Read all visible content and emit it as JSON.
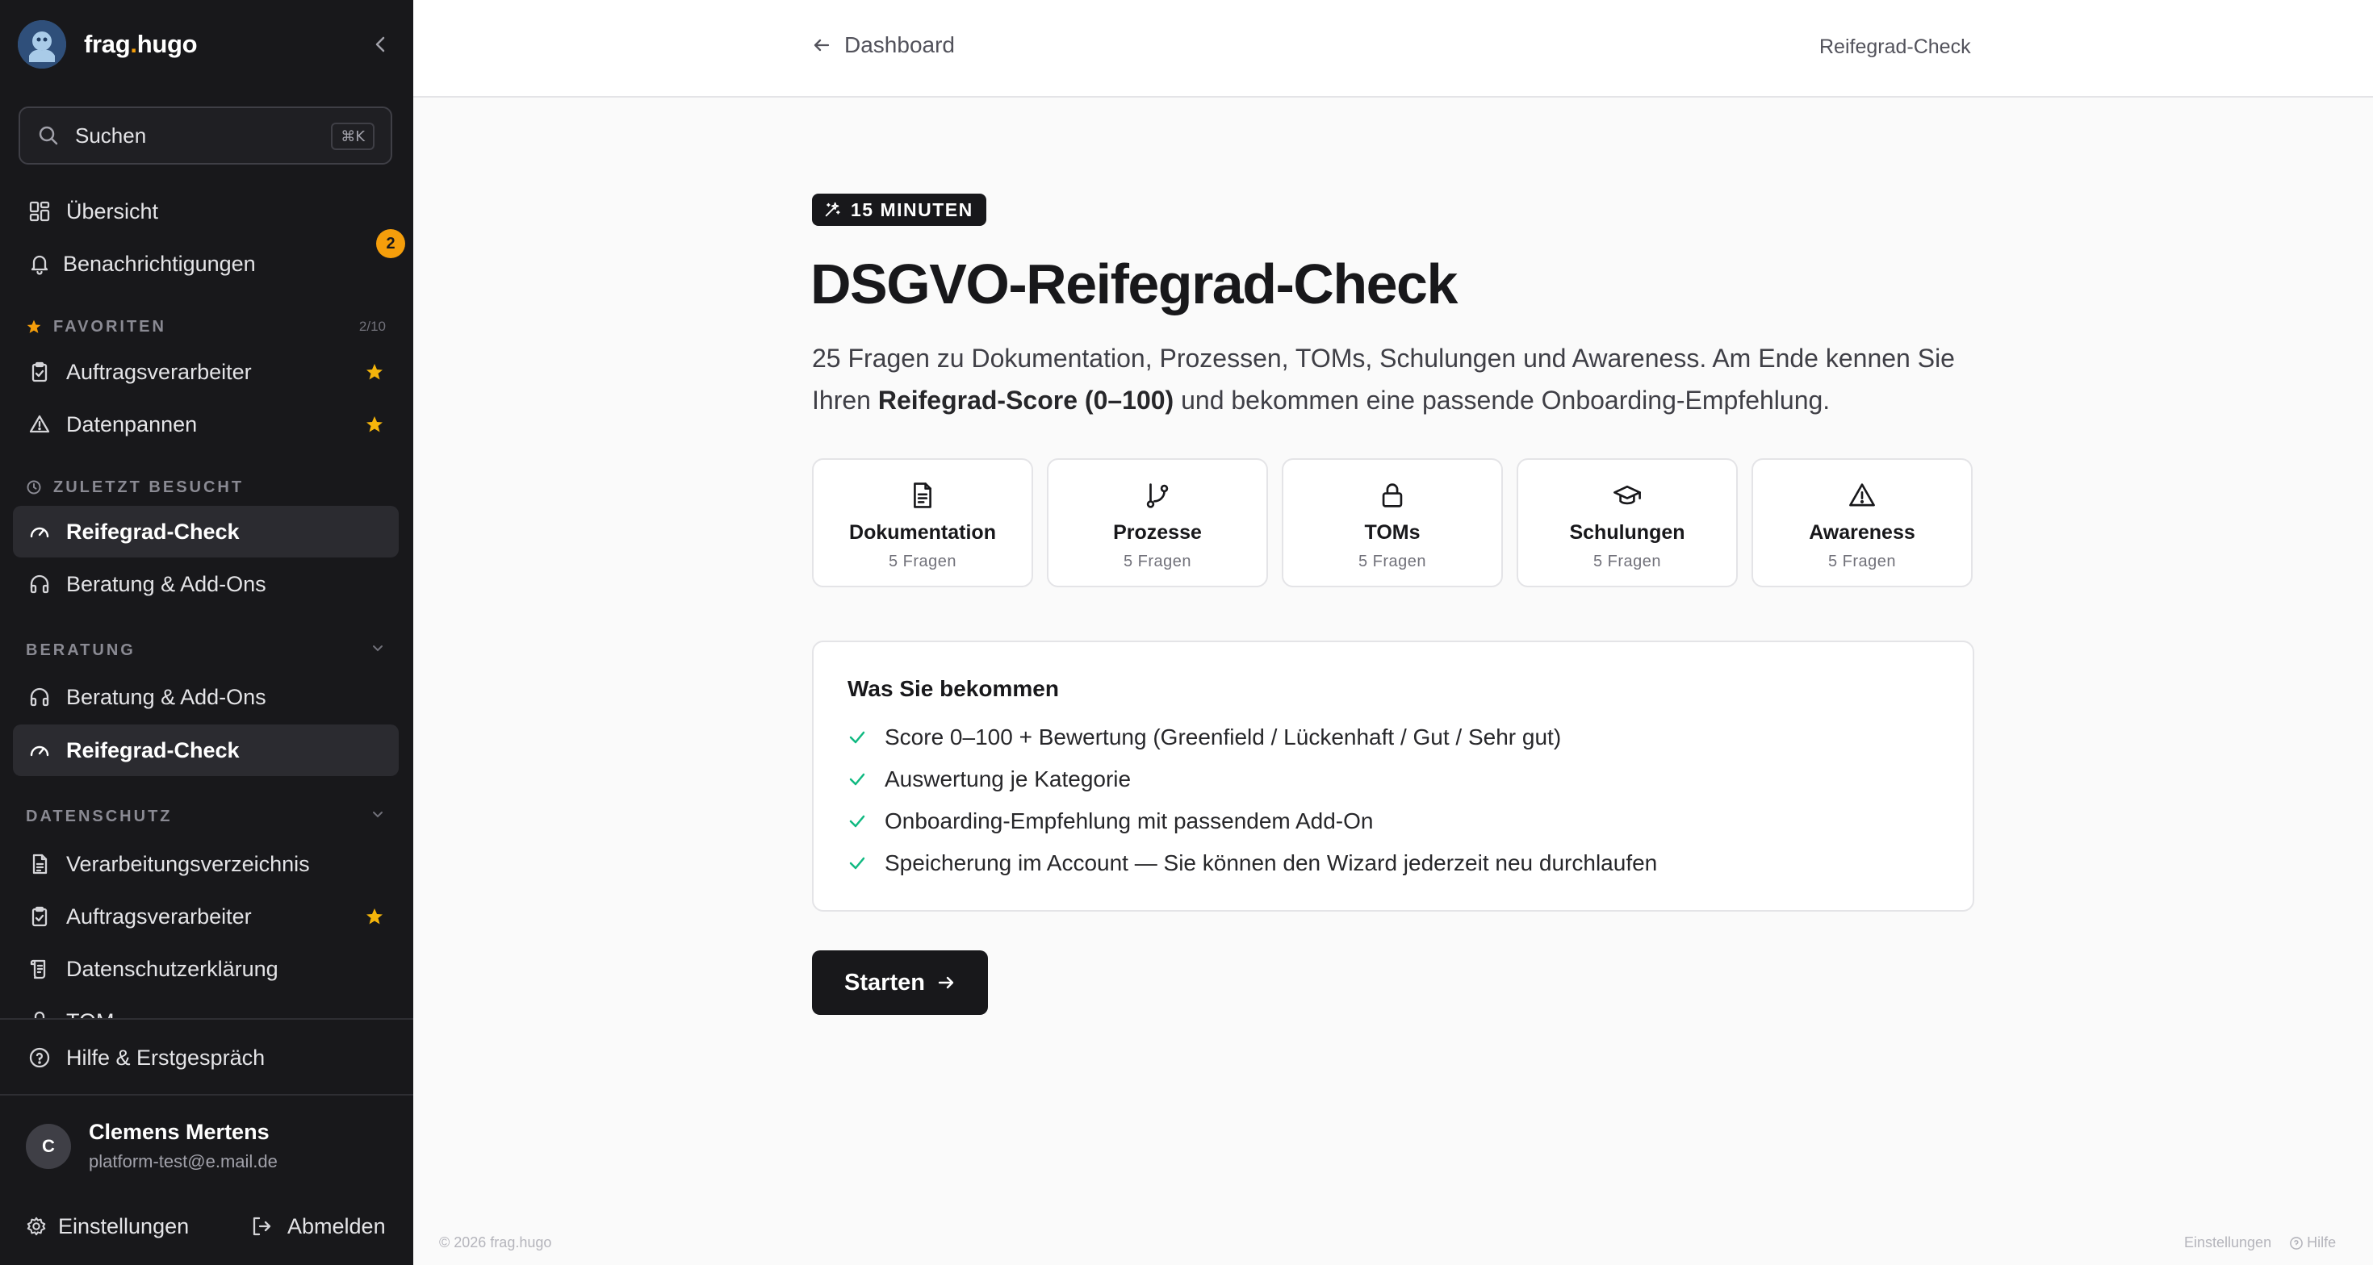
{
  "sidebar": {
    "brand": {
      "prefix": "frag",
      "dot": ".",
      "suffix": "hugo"
    },
    "search": {
      "label": "Suchen",
      "shortcut": "⌘K"
    },
    "main_items": [
      {
        "label": "Übersicht",
        "icon": "grid-icon"
      },
      {
        "label": "Benachrichtigungen",
        "icon": "bell-icon",
        "badge": "2"
      }
    ],
    "favorites": {
      "heading": "FAVORITEN",
      "count": "2/10",
      "items": [
        {
          "label": "Auftragsverarbeiter",
          "icon": "clipboard-check-icon",
          "starred": true
        },
        {
          "label": "Datenpannen",
          "icon": "warning-icon",
          "starred": true
        }
      ]
    },
    "recent": {
      "heading": "ZULETZT BESUCHT",
      "items": [
        {
          "label": "Reifegrad-Check",
          "icon": "gauge-icon",
          "active": true
        },
        {
          "label": "Beratung & Add-Ons",
          "icon": "headphones-icon"
        }
      ]
    },
    "beratung": {
      "heading": "BERATUNG",
      "items": [
        {
          "label": "Beratung & Add-Ons",
          "icon": "headphones-icon"
        },
        {
          "label": "Reifegrad-Check",
          "icon": "gauge-icon",
          "active": true
        }
      ]
    },
    "datenschutz": {
      "heading": "DATENSCHUTZ",
      "items": [
        {
          "label": "Verarbeitungsverzeichnis",
          "icon": "document-icon"
        },
        {
          "label": "Auftragsverarbeiter",
          "icon": "clipboard-check-icon",
          "starred": true
        },
        {
          "label": "Datenschutzerklärung",
          "icon": "scroll-icon"
        },
        {
          "label": "TOM",
          "icon": "lock-icon"
        }
      ]
    },
    "help": {
      "label": "Hilfe & Erstgespräch"
    },
    "user": {
      "initial": "C",
      "name": "Clemens Mertens",
      "email": "platform-test@e.mail.de"
    },
    "settings_label": "Einstellungen",
    "logout_label": "Abmelden"
  },
  "topbar": {
    "back_label": "Dashboard",
    "breadcrumb": "Reifegrad-Check"
  },
  "main": {
    "pill": "15 MINUTEN",
    "title": "DSGVO-Reifegrad-Check",
    "desc_part1": "25 Fragen zu Dokumentation, Prozessen, TOMs, Schulungen und Awareness. Am Ende kennen Sie Ihren ",
    "desc_bold": "Reifegrad-Score (0–100)",
    "desc_part2": " und bekommen eine passende Onboarding-Empfehlung.",
    "categories": [
      {
        "name": "Dokumentation",
        "sub": "5 Fragen",
        "icon": "document-icon"
      },
      {
        "name": "Prozesse",
        "sub": "5 Fragen",
        "icon": "git-branch-icon"
      },
      {
        "name": "TOMs",
        "sub": "5 Fragen",
        "icon": "lock-icon"
      },
      {
        "name": "Schulungen",
        "sub": "5 Fragen",
        "icon": "graduation-cap-icon"
      },
      {
        "name": "Awareness",
        "sub": "5 Fragen",
        "icon": "warning-icon"
      }
    ],
    "benefits_title": "Was Sie bekommen",
    "benefits": [
      "Score 0–100 + Bewertung (Greenfield / Lückenhaft / Gut / Sehr gut)",
      "Auswertung je Kategorie",
      "Onboarding-Empfehlung mit passendem Add-On",
      "Speicherung im Account — Sie können den Wizard jederzeit neu durchlaufen"
    ],
    "start_label": "Starten"
  },
  "footer": {
    "copyright": "© 2026 frag.hugo",
    "settings": "Einstellungen",
    "help": "Hilfe"
  },
  "colors": {
    "sidebar_bg": "#18181b",
    "accent": "#f59e0b",
    "check": "#10b981"
  }
}
